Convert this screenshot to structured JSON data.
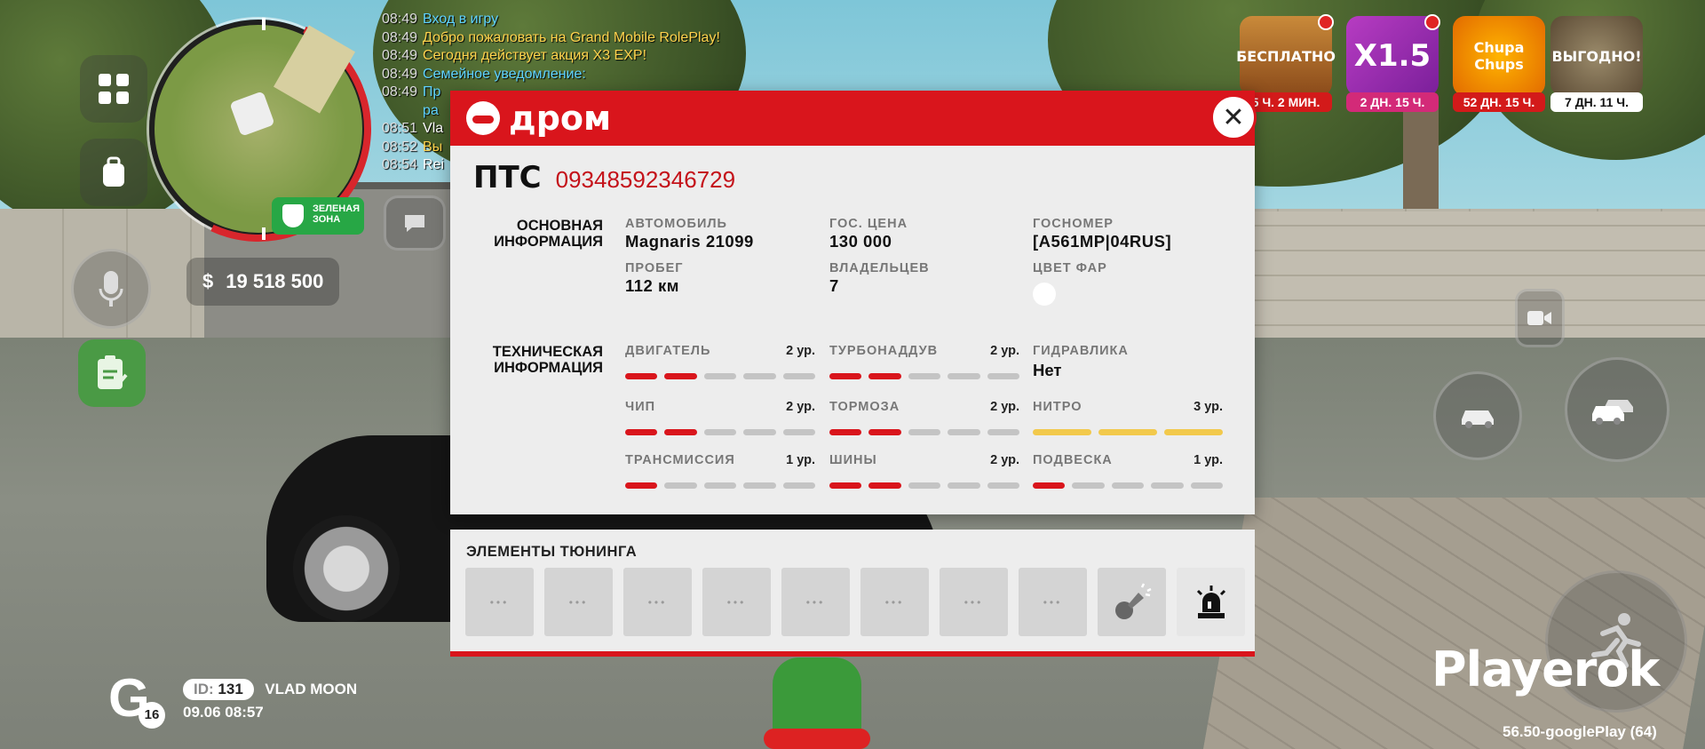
{
  "chat": [
    {
      "time": "08:49",
      "text": "Вход в игру",
      "color": "#5fd3ff"
    },
    {
      "time": "08:49",
      "text": "Добро пожаловать на Grand Mobile RolePlay!",
      "color": "#ffd34d"
    },
    {
      "time": "08:49",
      "text": "Сегодня действует акция X3 EXP!",
      "color": "#ffd34d"
    },
    {
      "time": "08:49",
      "text": "Семейное уведомление:",
      "color": "#5fd3ff"
    },
    {
      "time": "08:49",
      "text": "Пр",
      "color": "#5fd3ff"
    },
    {
      "time": "",
      "text": "ра",
      "color": "#5fd3ff"
    },
    {
      "time": "08:51",
      "text": "Vla",
      "color": "#ffffff"
    },
    {
      "time": "08:52",
      "text": "Вы",
      "color": "#ffd34d"
    },
    {
      "time": "08:54",
      "text": "Rei",
      "color": "#ffffff"
    }
  ],
  "hud": {
    "zone_label": "ЗЕЛЕНАЯ ЗОНА",
    "money_symbol": "$",
    "money": "19 518 500",
    "promos": [
      {
        "tag": "БЕСПЛАТНО",
        "timer": "5 Ч. 2 МИН."
      },
      {
        "tag": "X1.5",
        "timer": "2 ДН. 15 Ч."
      },
      {
        "tag": "Chupa Chups",
        "timer": "52 ДН. 15 Ч."
      },
      {
        "tag": "ВЫГОДНО!",
        "timer": "7 ДН. 11 Ч."
      }
    ],
    "player": {
      "id_label": "ID:",
      "id": "131",
      "name": "VLAD MOON",
      "date": "09.06",
      "time": "08:57",
      "level": "16"
    },
    "watermark": "Playerok",
    "version": "56.50-googlePlay (64)"
  },
  "dialog": {
    "brand": "дром",
    "close_icon": "close-icon",
    "pts_label": "ПТС",
    "pts_number": "09348592346729",
    "basic_title": "ОСНОВНАЯ ИНФОРМАЦИЯ",
    "basic": [
      {
        "k": "АВТОМОБИЛЬ",
        "v": "Magnaris 21099"
      },
      {
        "k": "ГОС. ЦЕНА",
        "v": "130 000"
      },
      {
        "k": "ГОСНОМЕР",
        "v": "[A561MP|04RUS]"
      },
      {
        "k": "ПРОБЕГ",
        "v": "112 км"
      },
      {
        "k": "ВЛАДЕЛЬЦЕВ",
        "v": "7"
      },
      {
        "k": "ЦВЕТ ФАР",
        "v": ""
      }
    ],
    "headlight_color": "#ffffff",
    "tech_title": "ТЕХНИЧЕСКАЯ ИНФОРМАЦИЯ",
    "tech": [
      {
        "k": "ДВИГАТЕЛЬ",
        "lv": "2 ур.",
        "level": 2,
        "max": 5
      },
      {
        "k": "ТУРБОНАДДУВ",
        "lv": "2 ур.",
        "level": 2,
        "max": 5
      },
      {
        "k": "ГИДРАВЛИКА",
        "v": "Нет"
      },
      {
        "k": "ЧИП",
        "lv": "2 ур.",
        "level": 2,
        "max": 5
      },
      {
        "k": "ТОРМОЗА",
        "lv": "2 ур.",
        "level": 2,
        "max": 5
      },
      {
        "k": "НИТРО",
        "lv": "3 ур.",
        "level": 3,
        "max": 3,
        "color": "#f2c94c"
      },
      {
        "k": "ТРАНСМИССИЯ",
        "lv": "1 ур.",
        "level": 1,
        "max": 5
      },
      {
        "k": "ШИНЫ",
        "lv": "2 ур.",
        "level": 2,
        "max": 5
      },
      {
        "k": "ПОДВЕСКА",
        "lv": "1 ур.",
        "level": 1,
        "max": 5
      }
    ],
    "accent": "#d9151c"
  },
  "tuning": {
    "title": "ЭЛЕМЕНТЫ ТЮНИНГА",
    "slots": [
      "•••",
      "•••",
      "•••",
      "•••",
      "•••",
      "•••",
      "•••",
      "•••",
      "horn-icon",
      "siren-icon"
    ]
  }
}
